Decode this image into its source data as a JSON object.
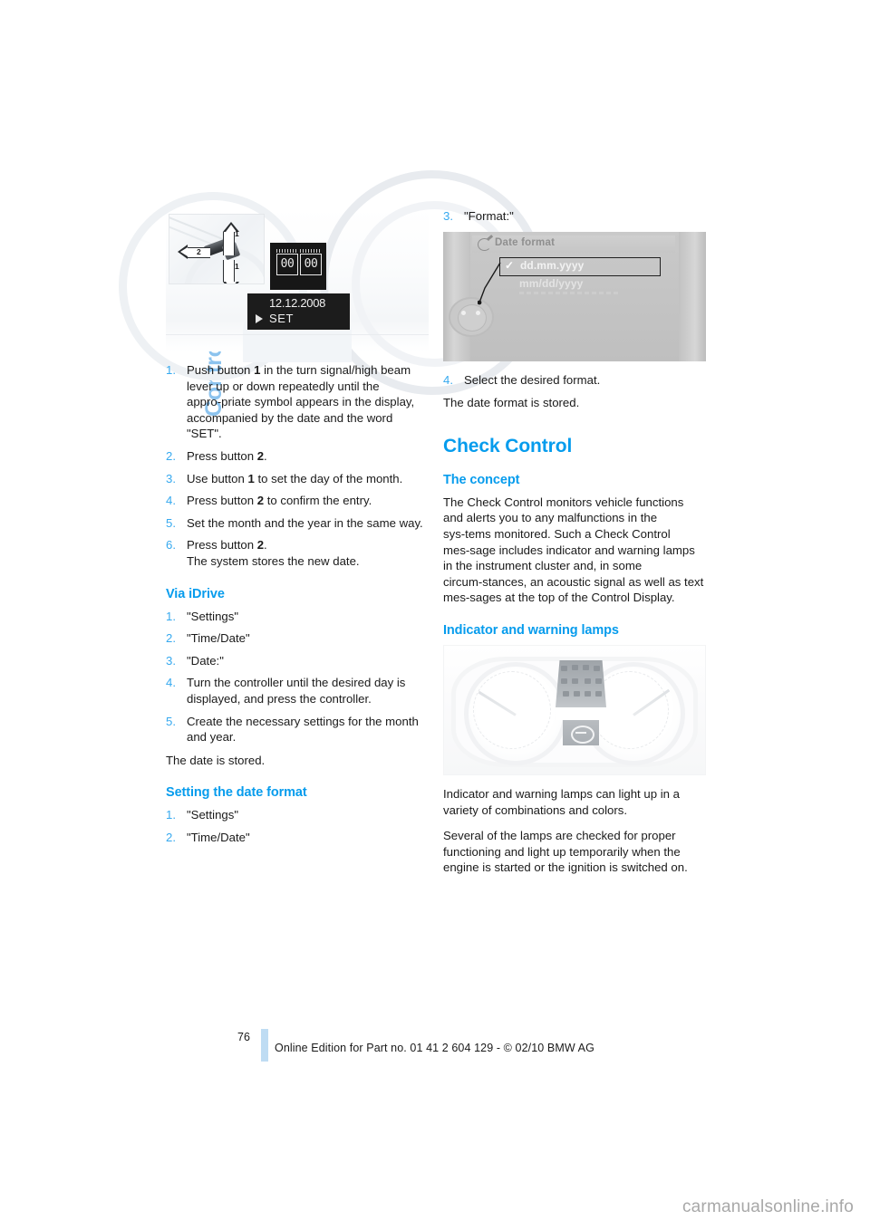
{
  "chapter_tab": {
    "label": "Controls overview"
  },
  "left_column": {
    "figure_lever": {
      "caption_id": "",
      "callout_1": "1",
      "callout_1b": "1",
      "callout_2": "2",
      "segment_left": "00",
      "segment_right": "00",
      "date_value": "12.12.2008",
      "set_label": "SET"
    },
    "steps_manual": [
      "Push button 1 in the turn signal/high beam lever up or down repeatedly until the appropriate symbol appears in the display, accompanied by the date and the word \"SET\".",
      "Press button 2.",
      "Use button 1 to set the day of the month.",
      "Press button 2 to confirm the entry.",
      "Set the month and the year in the same way.",
      "Press button 2."
    ],
    "steps_manual_6_sub": "The system stores the new date.",
    "via_idrive_heading": "Via iDrive",
    "steps_idrive": [
      "\"Settings\"",
      "\"Time/Date\"",
      "\"Date:\"",
      "Turn the controller until the desired day is displayed, and press the controller.",
      "Create the necessary settings for the month and year."
    ],
    "date_stored_text": "The date is stored.",
    "date_format_heading": "Setting the date format",
    "steps_format": [
      "\"Settings\"",
      "\"Time/Date\""
    ]
  },
  "right_column": {
    "step_3_format": "\"Format:\"",
    "figure_idrive": {
      "header_title": "Date format",
      "header_icon": "clock-icon",
      "option_selected": "dd.mm.yyyy",
      "option_other": "mm/dd/yyyy",
      "checkmark": "✓"
    },
    "step_4_select": "Select the desired format.",
    "format_stored_text": "The date format is stored.",
    "check_control_heading": "Check Control",
    "concept_heading": "The concept",
    "concept_paragraph": "The Check Control monitors vehicle functions and alerts you to any malfunctions in the systems monitored. Such a Check Control message includes indicator and warning lamps in the instrument cluster and, in some circumstances, an acoustic signal as well as text messages at the top of the Control Display.",
    "lamps_heading": "Indicator and warning lamps",
    "lamps_paragraph_1": "Indicator and warning lamps can light up in a variety of combinations and colors.",
    "lamps_paragraph_2": "Several of the lamps are checked for proper functioning and light up temporarily when the engine is started or the ignition is switched on."
  },
  "footer": {
    "page_number": "76",
    "edition_text": "Online Edition for Part no. 01 41 2 604 129 - © 02/10 BMW AG"
  },
  "watermark": {
    "text": "carmanualsonline.info"
  },
  "colors": {
    "heading_blue": "#069ced",
    "tab_blue": "#8cc3ee",
    "step_number_blue": "#36a9ef",
    "footer_bar_blue": "#bfdcf3",
    "body_text": "#1a1a1a"
  }
}
